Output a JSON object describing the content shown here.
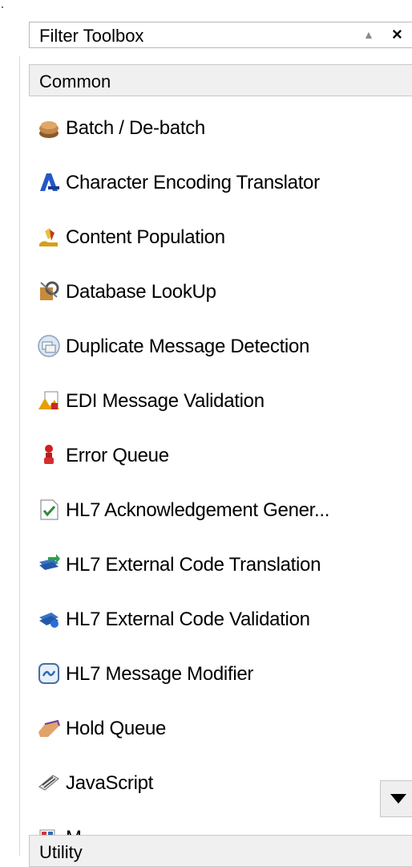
{
  "toolbox": {
    "title": "Filter Toolbox",
    "collapse_glyph": "▲",
    "close_glyph": "×"
  },
  "sections": {
    "common": "Common",
    "utility": "Utility"
  },
  "items": [
    {
      "label": "Batch / De-batch",
      "icon": "batch-box-icon"
    },
    {
      "label": "Character Encoding Translator",
      "icon": "encoding-icon"
    },
    {
      "label": "Content Population",
      "icon": "content-population-icon"
    },
    {
      "label": "Database LookUp",
      "icon": "database-lookup-icon"
    },
    {
      "label": "Duplicate Message Detection",
      "icon": "duplicate-detection-icon"
    },
    {
      "label": "EDI Message Validation",
      "icon": "edi-validation-icon"
    },
    {
      "label": "Error Queue",
      "icon": "error-queue-icon"
    },
    {
      "label": "HL7 Acknowledgement Gener...",
      "icon": "hl7-ack-icon"
    },
    {
      "label": "HL7 External Code Translation",
      "icon": "hl7-translation-icon"
    },
    {
      "label": "HL7 External Code Validation",
      "icon": "hl7-validation-icon"
    },
    {
      "label": "HL7 Message Modifier",
      "icon": "hl7-modifier-icon"
    },
    {
      "label": "Hold Queue",
      "icon": "hold-queue-icon"
    },
    {
      "label": "JavaScript",
      "icon": "javascript-icon"
    },
    {
      "label": "M...",
      "icon": "partial-item-icon"
    }
  ],
  "scroll": {
    "glyph": "▼"
  }
}
